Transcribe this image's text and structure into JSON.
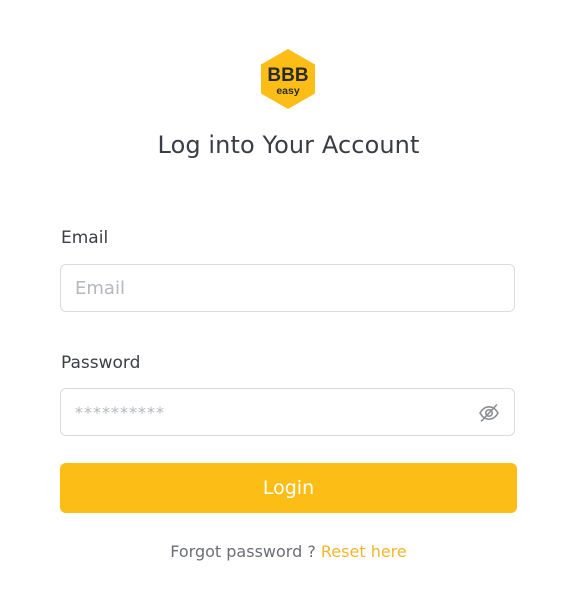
{
  "logo": {
    "line1": "BBB",
    "line2": "easy",
    "color": "#fcbd16",
    "text_color": "#2a2a2a"
  },
  "page_title": "Log into Your Account",
  "email": {
    "label": "Email",
    "placeholder": "Email",
    "value": ""
  },
  "password": {
    "label": "Password",
    "placeholder": "**********",
    "value": "",
    "toggle_icon": "eye-slash-icon"
  },
  "login_button": {
    "label": "Login",
    "color": "#fcbd16"
  },
  "forgot": {
    "text": "Forgot password ?",
    "link_text": "Reset here",
    "link_color": "#f3b52b"
  }
}
